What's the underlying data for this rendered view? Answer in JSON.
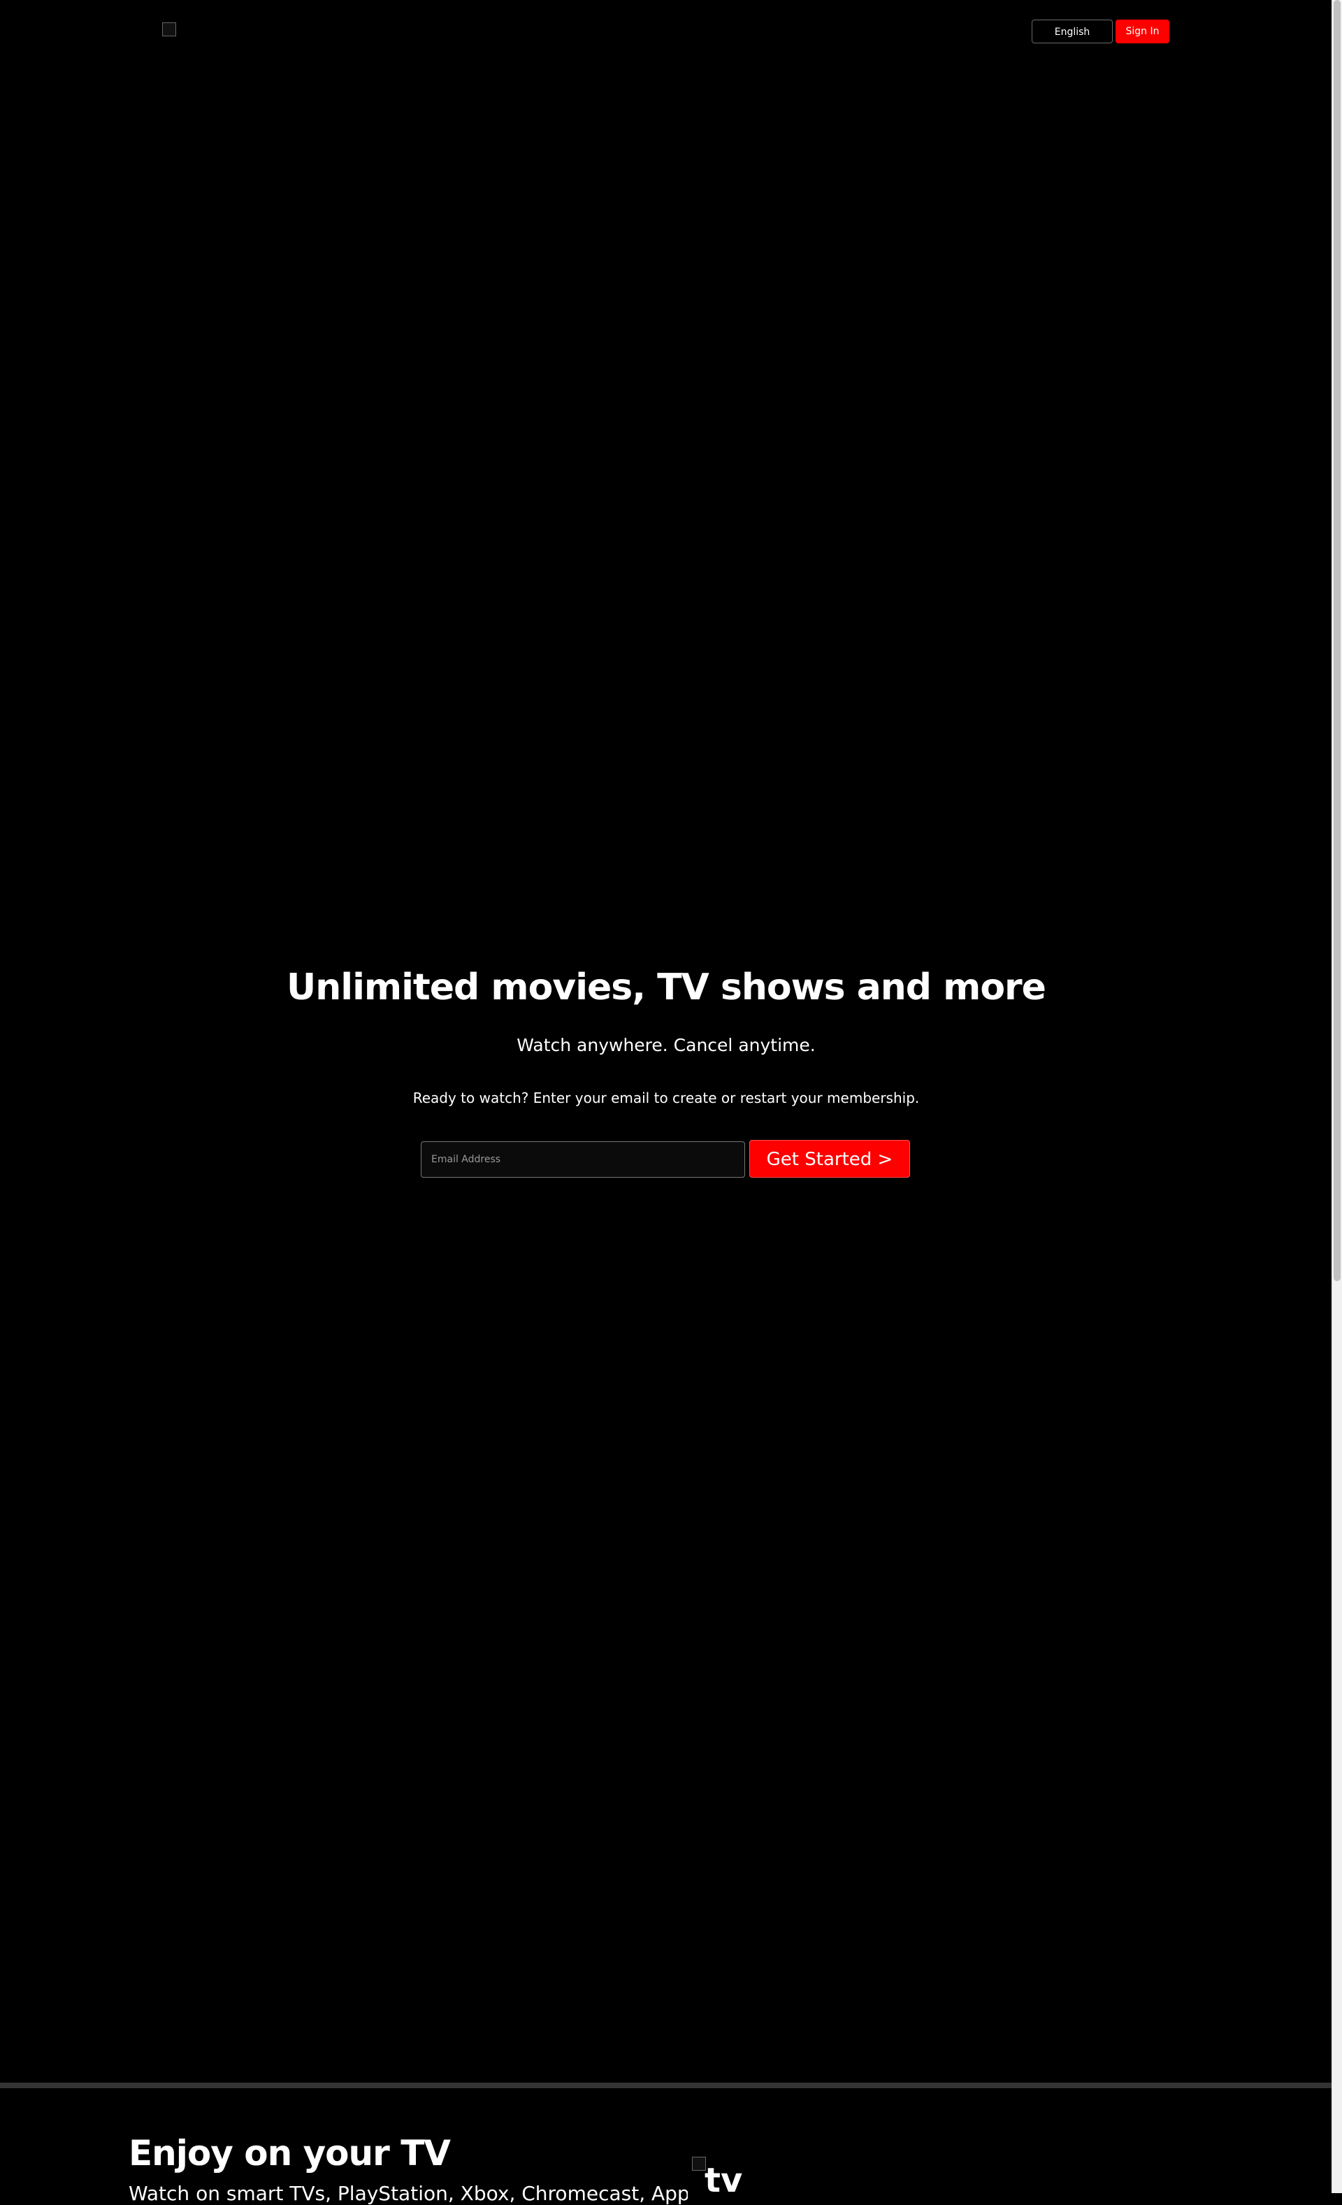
{
  "header": {
    "language": "English",
    "signin_label": "Sign In"
  },
  "hero": {
    "title": "Unlimited movies, TV shows and more",
    "subtitle": "Watch anywhere. Cancel anytime.",
    "prompt": "Ready to watch? Enter your email to create or restart your membership.",
    "email_placeholder": "Email Address",
    "cta_label": "Get Started >"
  },
  "feature_tv": {
    "title": "Enjoy on your TV",
    "text": "Watch on smart TVs, PlayStation, Xbox, Chromecast, Apple TV, Blu-",
    "image_alt": "tv"
  },
  "colors": {
    "accent": "#ff0000",
    "background": "#000000",
    "divider": "#333333"
  }
}
